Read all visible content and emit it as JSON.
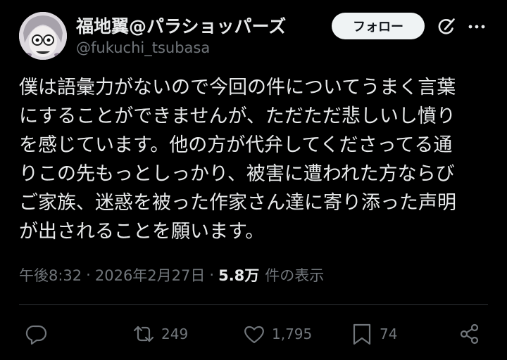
{
  "author": {
    "display_name": "福地翼@パラショッパーズ",
    "handle": "@fukuchi_tsubasa"
  },
  "follow_label": "フォロー",
  "tweet": {
    "lines": [
      "僕は語彙力がないので今回の件についてうまく言葉",
      "にすることができませんが、ただただ悲しいし憤り",
      "を感じています。他の方が代弁してくださってる通",
      "りこの先もっとしっかり、被害に遭われた方ならび",
      "ご家族、迷惑を被った作家さん達に寄り添った声明",
      "が出されることを願います。"
    ]
  },
  "meta": {
    "time": "午後8:32",
    "separator": "·",
    "date": "2026年2月27日",
    "views": "5.8万",
    "views_label": "件の表示"
  },
  "actions": {
    "retweets": "249",
    "likes": "1,795",
    "bookmarks": "74"
  },
  "icons": {
    "reply": "reply-icon",
    "retweet": "retweet-icon",
    "like": "heart-icon",
    "bookmark": "bookmark-icon",
    "share": "share-icon",
    "grok": "grok-icon",
    "more": "more-icon"
  },
  "colors": {
    "background": "#000000",
    "text": "#e7e9ea",
    "secondary": "#71767b",
    "button": "#eff3f4"
  }
}
